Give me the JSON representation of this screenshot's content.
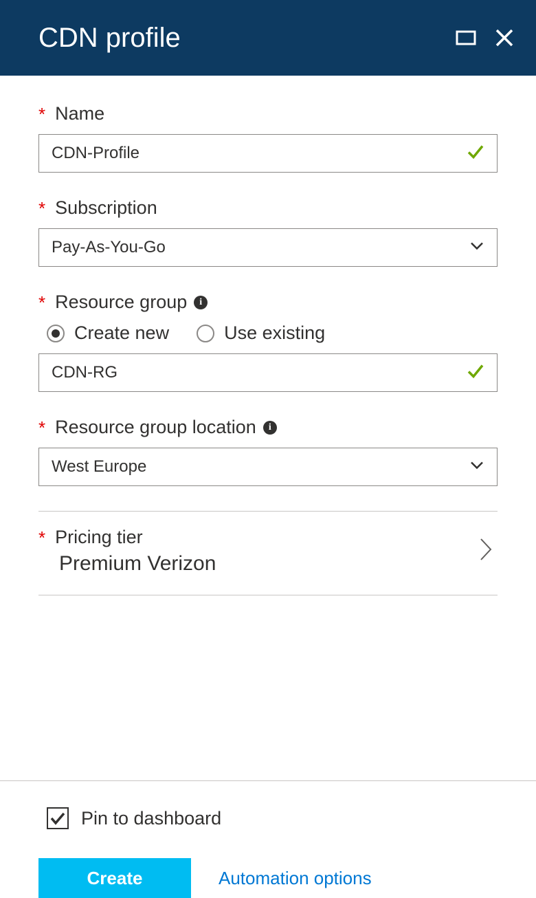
{
  "header": {
    "title": "CDN profile"
  },
  "fields": {
    "name": {
      "label": "Name",
      "value": "CDN-Profile"
    },
    "subscription": {
      "label": "Subscription",
      "value": "Pay-As-You-Go"
    },
    "resource_group": {
      "label": "Resource group",
      "create_label": "Create new",
      "existing_label": "Use existing",
      "selected_mode": "create",
      "value": "CDN-RG"
    },
    "location": {
      "label": "Resource group location",
      "value": "West Europe"
    },
    "pricing": {
      "label": "Pricing tier",
      "value": "Premium Verizon"
    }
  },
  "footer": {
    "pin_label": "Pin to dashboard",
    "pin_checked": true,
    "create_label": "Create",
    "automation_label": "Automation options"
  }
}
